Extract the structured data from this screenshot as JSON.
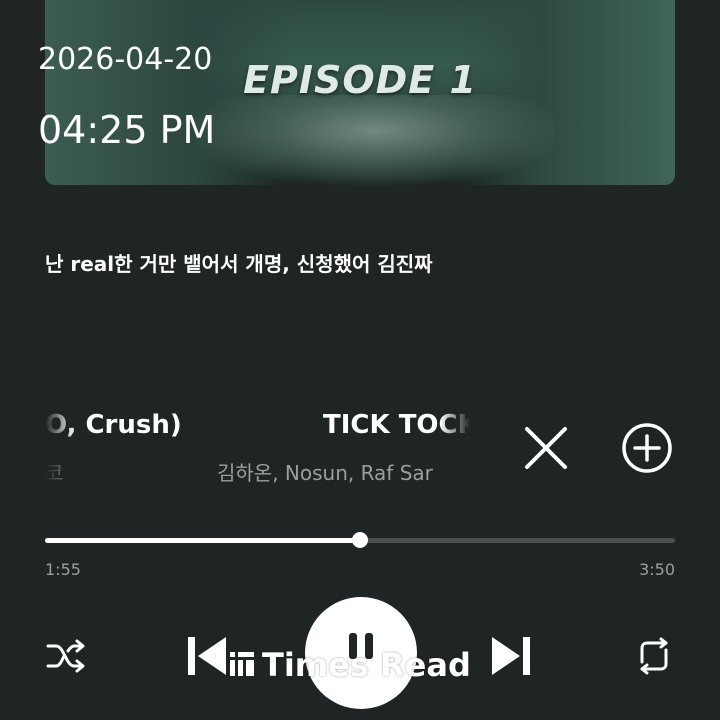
{
  "overlay": {
    "date": "2026-04-20",
    "time": "04:25 PM"
  },
  "album_art": {
    "title": "EPISODE 1"
  },
  "lyric": "난 real한 거만 뱉어서 개명, 신청했어 김진짜",
  "track": {
    "prev_title_fragment": "O, Crush)",
    "prev_artist_fragment": "코",
    "title": "TICK TOCK",
    "artists": "김하온, Nosun, Raf Sar"
  },
  "progress": {
    "current": "1:55",
    "total": "3:50",
    "fraction": 0.5
  },
  "watermark": "Times Read",
  "icons": {
    "close": "close-icon",
    "add": "add-circle-icon",
    "shuffle": "shuffle-icon",
    "prev": "skip-previous-icon",
    "pause": "pause-icon",
    "next": "skip-next-icon",
    "repeat": "repeat-icon"
  },
  "colors": {
    "background": "#1f2424",
    "accent": "#ffffff",
    "muted": "#9aa0a0"
  }
}
